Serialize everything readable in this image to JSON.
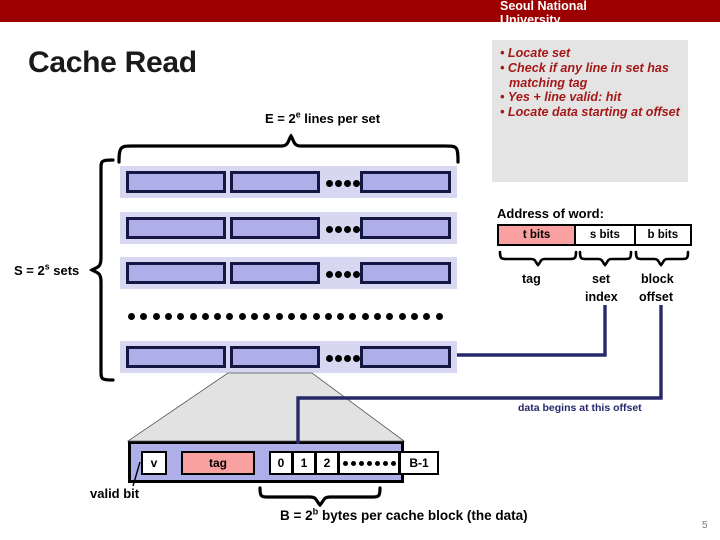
{
  "banner": {
    "university": "Seoul National\nUniversity",
    "color": "#9c0000"
  },
  "title": "Cache Read",
  "callout": {
    "items": [
      "Locate set",
      "Check if any line in set has matching tag",
      "Yes + line valid: hit",
      "Locate data starting at offset"
    ],
    "text_color": "#a51818",
    "background": "#e4e4e4"
  },
  "diagram": {
    "lines_per_set_label": "E = 2",
    "lines_per_set_sup": "e",
    "lines_per_set_tail": " lines per set",
    "sets_label": "S = 2",
    "sets_sup": "s",
    "sets_tail": " sets",
    "set_count_visible": 4,
    "lines_per_row_visible": 3,
    "ellipsis_dots_per_row": 4,
    "line_fill": "#aeaee8",
    "band_fill": "#d7d7f2",
    "line_border": "#161642"
  },
  "address": {
    "title": "Address of word:",
    "segments": [
      {
        "label": "t bits",
        "color": "#f9a0a0"
      },
      {
        "label": "s bits",
        "color": "#ffffff"
      },
      {
        "label": "b bits",
        "color": "#ffffff"
      }
    ],
    "brace_labels": {
      "tag": "tag",
      "set": "set",
      "index": "index",
      "block": "block",
      "offset": "offset"
    }
  },
  "detail_line": {
    "valid": "v",
    "tag": "tag",
    "tag_color": "#f9a0a0",
    "bytes": [
      "0",
      "1",
      "2"
    ],
    "last_byte": "B-1",
    "valid_bit_label": "valid bit",
    "capacity_label_pre": "B = 2",
    "capacity_label_sup": "b",
    "capacity_label_post": " bytes per cache block (the data)"
  },
  "annotations": {
    "offset_note": "data begins at this offset",
    "connector_color": "#26286b"
  },
  "slide_number": "5"
}
